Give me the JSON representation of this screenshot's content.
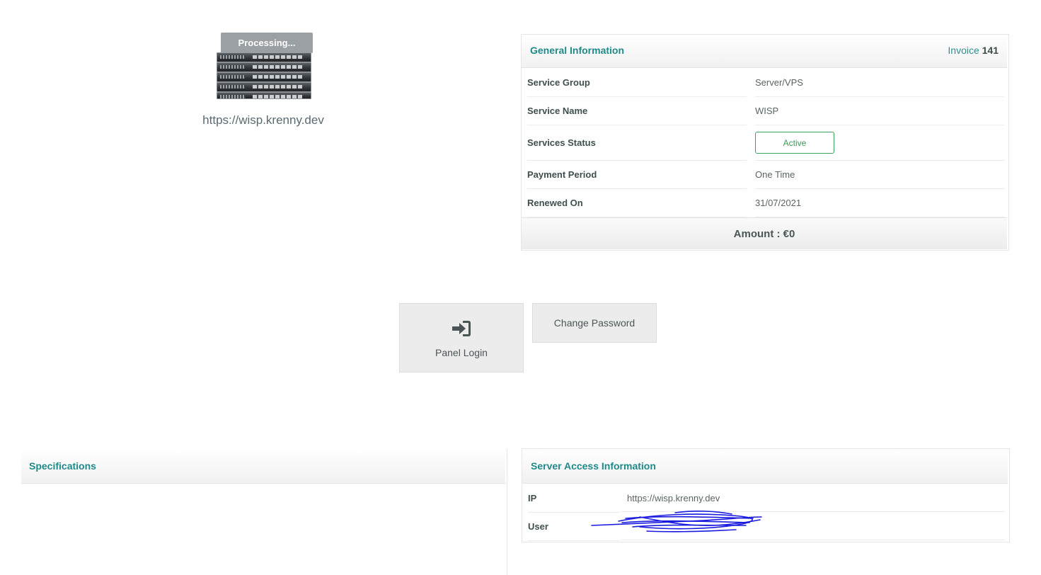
{
  "service_image": {
    "overlay_text": "Processing...",
    "domain": "https://wisp.krenny.dev"
  },
  "general_info": {
    "title": "General Information",
    "invoice_label": "Invoice",
    "invoice_number": "141",
    "rows": [
      {
        "label": "Service Group",
        "value": "Server/VPS"
      },
      {
        "label": "Service Name",
        "value": "WISP"
      },
      {
        "label": "Services Status",
        "value": "Active"
      },
      {
        "label": "Payment Period",
        "value": "One Time"
      },
      {
        "label": "Renewed On",
        "value": "31/07/2021"
      }
    ],
    "amount": "Amount : €0",
    "status_color": "#3aa35c"
  },
  "actions": {
    "panel_login": "Panel Login",
    "change_password": "Change Password"
  },
  "specifications": {
    "title": "Specifications"
  },
  "server_access": {
    "title": "Server Access Information",
    "rows": [
      {
        "label": "IP",
        "value": "https://wisp.krenny.dev"
      },
      {
        "label": "User",
        "value": ""
      }
    ]
  },
  "colors": {
    "accent": "#1f8a8a",
    "redaction": "#1a1adf"
  }
}
